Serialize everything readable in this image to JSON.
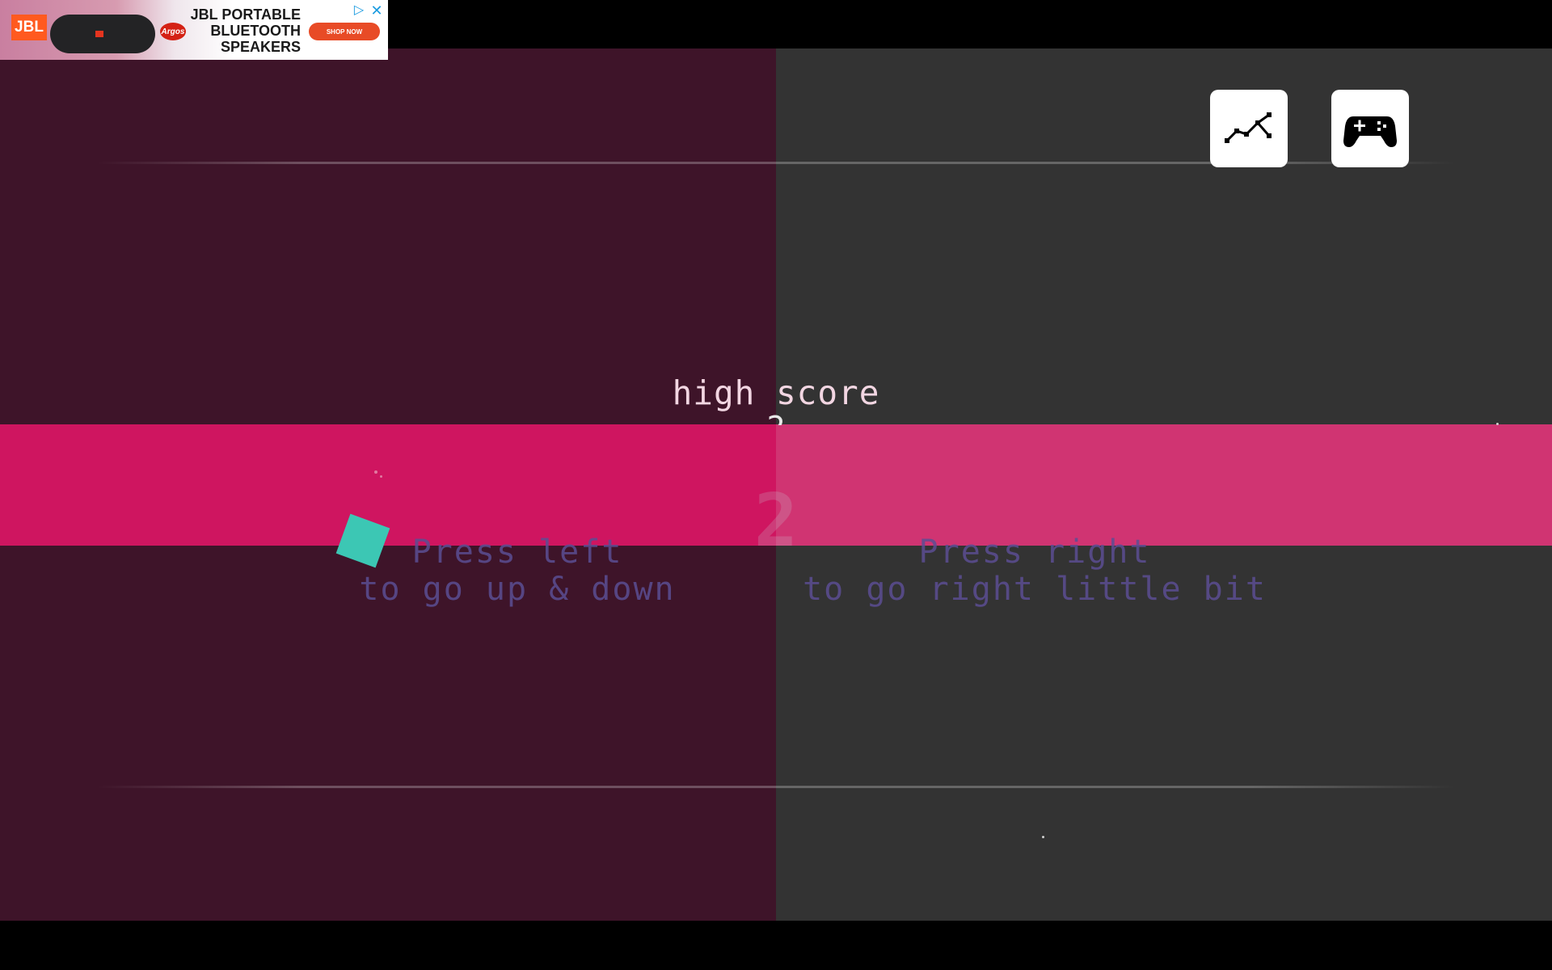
{
  "colors": {
    "left_panel": "#3e1429",
    "right_panel": "#333333",
    "band_left": "#cf1560",
    "band_right": "#d03472",
    "player": "#3cc7b4",
    "hint_text": "#5b4e93"
  },
  "toolbar": {
    "stats_icon": "stats-graph-icon",
    "gamepad_icon": "gamepad-icon"
  },
  "score": {
    "high_score_label": "high score",
    "high_score_value": "2",
    "current_score": "2"
  },
  "hints": {
    "left_line1": "Press left",
    "left_line2": "to go up & down",
    "right_line1": "Press right",
    "right_line2": "to go right little bit"
  },
  "ad": {
    "brand": "JBL",
    "retailer": "Argos",
    "title": "JBL PORTABLE BLUETOOTH SPEAKERS",
    "cta": "SHOP NOW",
    "choices_icon": "ad-choices-icon",
    "close_icon": "close-icon"
  }
}
